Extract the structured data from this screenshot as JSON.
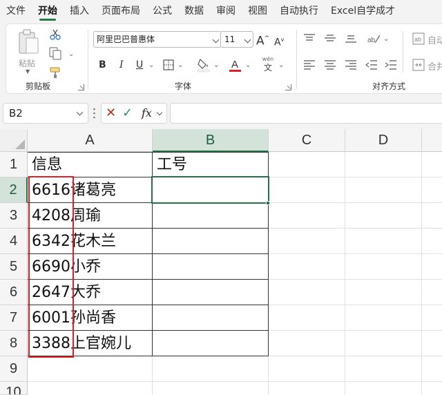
{
  "menu": {
    "tabs": [
      "文件",
      "开始",
      "插入",
      "页面布局",
      "公式",
      "数据",
      "审阅",
      "视图",
      "自动执行",
      "Excel自学成才"
    ],
    "active": "开始"
  },
  "ribbon": {
    "clipboard": {
      "paste_label": "粘贴",
      "group_label": "剪贴板"
    },
    "font": {
      "font_name": "阿里巴巴普惠体",
      "font_size": "11",
      "group_label": "字体",
      "bold": "B",
      "italic": "I",
      "underline": "U",
      "grow": "A",
      "shrink": "A",
      "phonetic_top": "wén",
      "phonetic_bottom": "文"
    },
    "alignment": {
      "group_label": "对齐方式",
      "wrap_label": "自动",
      "merge_label": "合并后"
    }
  },
  "formula_bar": {
    "name_box": "B2",
    "fx": "fx",
    "value": ""
  },
  "sheet": {
    "columns": [
      "A",
      "B",
      "C",
      "D"
    ],
    "selected_column": "B",
    "rows": [
      "1",
      "2",
      "3",
      "4",
      "5",
      "6",
      "7",
      "8",
      "9",
      "10"
    ],
    "selected_row": "2",
    "active_cell": "B2",
    "cells": {
      "A1": "信息",
      "B1": "工号",
      "A2": "6616诸葛亮",
      "A3": "4208周瑜",
      "A4": "6342花木兰",
      "A5": "6690小乔",
      "A6": "2647大乔",
      "A7": "6001孙尚香",
      "A8": "3388上官婉儿"
    }
  },
  "colors": {
    "excel_green": "#217346",
    "highlight_red": "#e02020",
    "font_color_bar": "#e02020",
    "ribbon_bg": "#f3f3f3"
  }
}
